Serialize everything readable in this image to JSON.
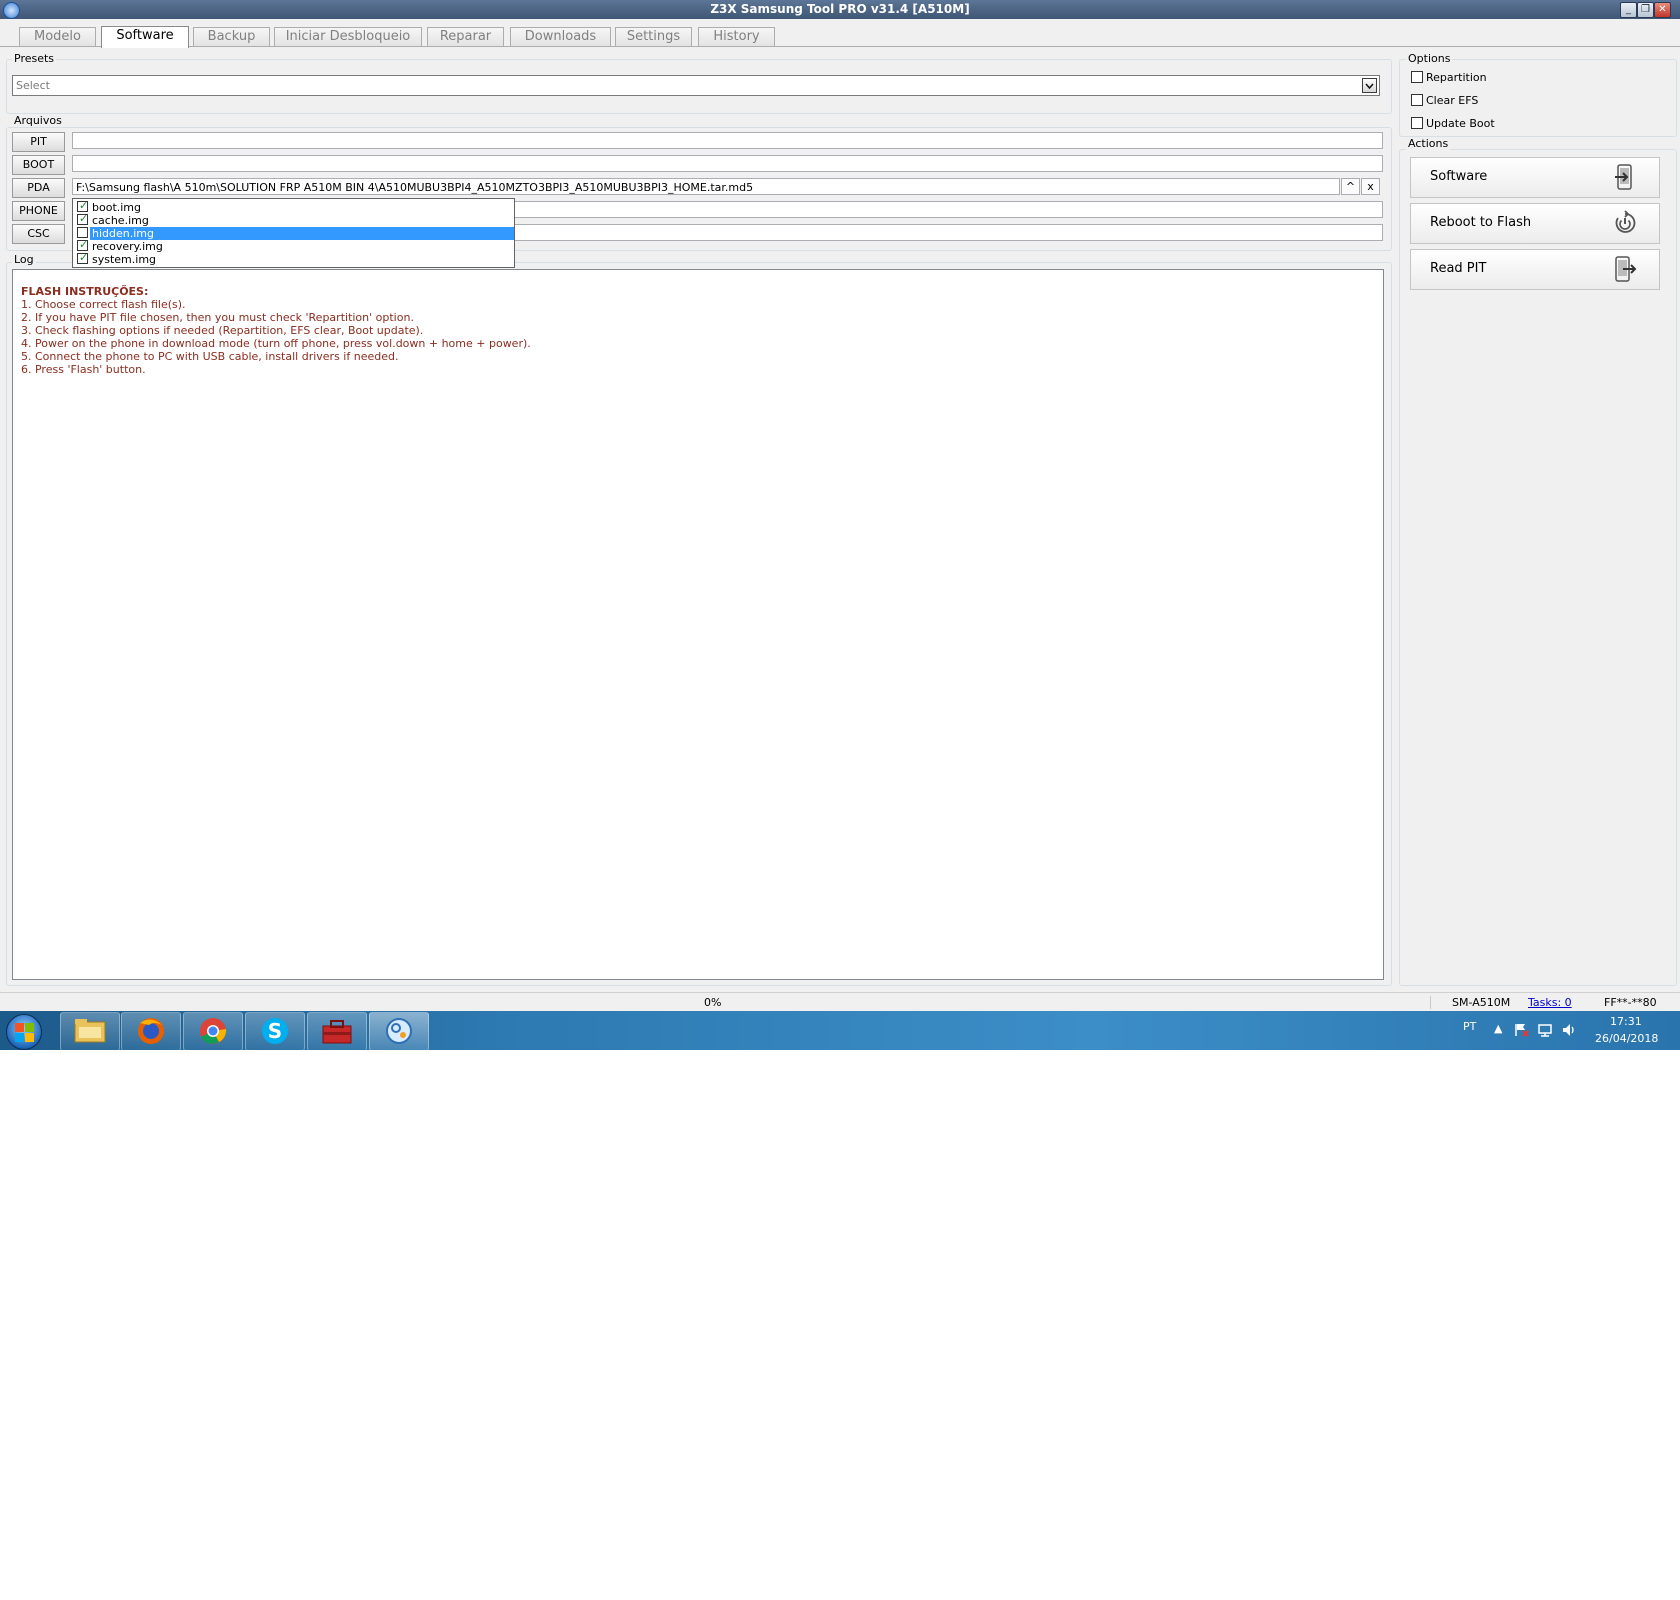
{
  "window": {
    "title": "Z3X Samsung Tool PRO v31.4 [A510M]"
  },
  "tabs": [
    {
      "label": "Modelo"
    },
    {
      "label": "Software"
    },
    {
      "label": "Backup"
    },
    {
      "label": "Iniciar Desbloqueio"
    },
    {
      "label": "Reparar"
    },
    {
      "label": "Downloads"
    },
    {
      "label": "Settings"
    },
    {
      "label": "History"
    }
  ],
  "presets": {
    "label": "Presets",
    "placeholder": "Select"
  },
  "arquivos": {
    "label": "Arquivos",
    "pit_label": "PIT",
    "boot_label": "BOOT",
    "pda_label": "PDA",
    "phone_label": "PHONE",
    "csc_label": "CSC",
    "pda_path": "F:\\Samsung flash\\A 510m\\SOLUTION FRP A510M BIN 4\\A510MUBU3BPI4_A510MZTO3BPI3_A510MUBU3BPI3_HOME.tar.md5",
    "up_symbol": "^",
    "clear_symbol": "x",
    "pda_items": [
      {
        "name": "boot.img",
        "checked": true
      },
      {
        "name": "cache.img",
        "checked": true
      },
      {
        "name": "hidden.img",
        "checked": false,
        "selected": true
      },
      {
        "name": "recovery.img",
        "checked": true
      },
      {
        "name": "system.img",
        "checked": true
      }
    ]
  },
  "log": {
    "label": "Log",
    "title": "FLASH INSTRUÇÕES:",
    "lines": [
      "1. Choose correct flash file(s).",
      "2. If you have PIT file chosen, then you must check 'Repartition' option.",
      "3. Check flashing options if needed (Repartition, EFS clear, Boot update).",
      "4. Power on the phone in download mode (turn off phone, press vol.down + home + power).",
      "5. Connect the phone to PC with USB cable, install drivers if needed.",
      "6. Press 'Flash' button."
    ]
  },
  "options": {
    "label": "Options",
    "repartition": "Repartition",
    "clear_efs": "Clear EFS",
    "update_boot": "Update Boot"
  },
  "actions": {
    "label": "Actions",
    "software": "Software",
    "reboot": "Reboot to Flash",
    "read_pit": "Read PIT"
  },
  "status": {
    "progress_text": "0%",
    "progress": 0,
    "model": "SM-A510M",
    "tasks": "Tasks: 0",
    "serial": "FF**-**80"
  },
  "taskbar": {
    "language": "PT",
    "time": "17:31",
    "date": "26/04/2018",
    "apps": [
      "explorer-icon",
      "firefox-icon",
      "chrome-icon",
      "skype-icon",
      "toolbox-icon",
      "z3x-icon"
    ]
  },
  "colors": {
    "log_text": "#8b2d1f",
    "selection": "#3399ff",
    "titlebar": "#4a6283"
  }
}
